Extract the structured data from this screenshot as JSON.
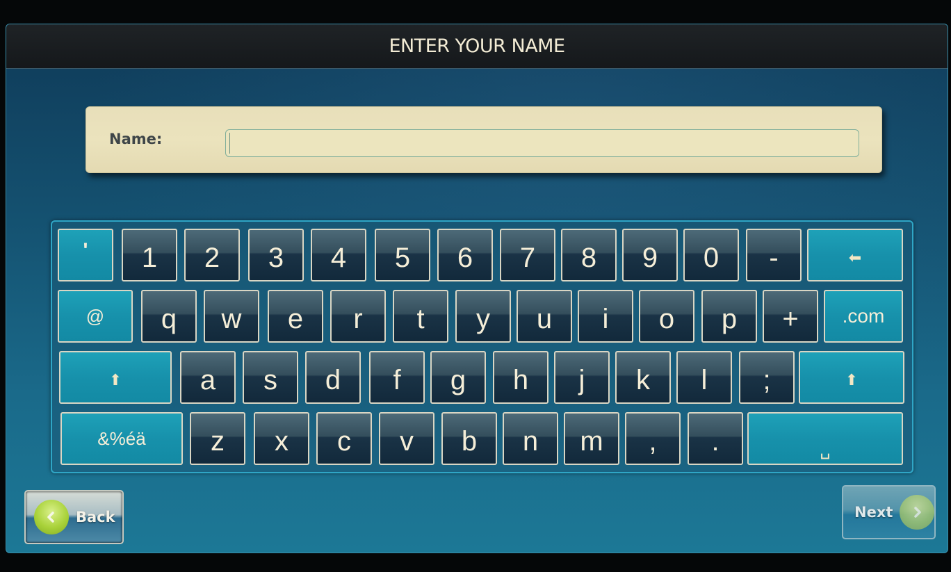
{
  "header": {
    "title": "ENTER YOUR NAME"
  },
  "form": {
    "name_label": "Name:",
    "name_value": "",
    "name_placeholder": ""
  },
  "keyboard": {
    "rows": [
      [
        {
          "id": "apostrophe",
          "label": "'",
          "style": "teal"
        },
        {
          "id": "1",
          "label": "1",
          "style": "dark"
        },
        {
          "id": "2",
          "label": "2",
          "style": "dark"
        },
        {
          "id": "3",
          "label": "3",
          "style": "dark"
        },
        {
          "id": "4",
          "label": "4",
          "style": "dark"
        },
        {
          "id": "5",
          "label": "5",
          "style": "dark"
        },
        {
          "id": "6",
          "label": "6",
          "style": "dark"
        },
        {
          "id": "7",
          "label": "7",
          "style": "dark"
        },
        {
          "id": "8",
          "label": "8",
          "style": "dark"
        },
        {
          "id": "9",
          "label": "9",
          "style": "dark"
        },
        {
          "id": "0",
          "label": "0",
          "style": "dark"
        },
        {
          "id": "hyphen",
          "label": "-",
          "style": "dark"
        },
        {
          "id": "backspace",
          "label": "⬅",
          "icon": "backspace-arrow-icon",
          "style": "teal"
        }
      ],
      [
        {
          "id": "at",
          "label": "@",
          "style": "teal"
        },
        {
          "id": "q",
          "label": "q",
          "style": "dark"
        },
        {
          "id": "w",
          "label": "w",
          "style": "dark"
        },
        {
          "id": "e",
          "label": "e",
          "style": "dark"
        },
        {
          "id": "r",
          "label": "r",
          "style": "dark"
        },
        {
          "id": "t",
          "label": "t",
          "style": "dark"
        },
        {
          "id": "y",
          "label": "y",
          "style": "dark"
        },
        {
          "id": "u",
          "label": "u",
          "style": "dark"
        },
        {
          "id": "i",
          "label": "i",
          "style": "dark"
        },
        {
          "id": "o",
          "label": "o",
          "style": "dark"
        },
        {
          "id": "p",
          "label": "p",
          "style": "dark"
        },
        {
          "id": "plus",
          "label": "+",
          "style": "dark"
        },
        {
          "id": "dotcom",
          "label": ".com",
          "style": "teal"
        }
      ],
      [
        {
          "id": "shift-left",
          "label": "⬆",
          "icon": "shift-arrow-icon",
          "style": "teal"
        },
        {
          "id": "a",
          "label": "a",
          "style": "dark"
        },
        {
          "id": "s",
          "label": "s",
          "style": "dark"
        },
        {
          "id": "d",
          "label": "d",
          "style": "dark"
        },
        {
          "id": "f",
          "label": "f",
          "style": "dark"
        },
        {
          "id": "g",
          "label": "g",
          "style": "dark"
        },
        {
          "id": "h",
          "label": "h",
          "style": "dark"
        },
        {
          "id": "j",
          "label": "j",
          "style": "dark"
        },
        {
          "id": "k",
          "label": "k",
          "style": "dark"
        },
        {
          "id": "l",
          "label": "l",
          "style": "dark"
        },
        {
          "id": "semicolon",
          "label": ";",
          "style": "dark"
        },
        {
          "id": "shift-right",
          "label": "⬆",
          "icon": "shift-arrow-icon",
          "style": "teal"
        }
      ],
      [
        {
          "id": "symbols",
          "label": "&%éä",
          "style": "teal"
        },
        {
          "id": "z",
          "label": "z",
          "style": "dark"
        },
        {
          "id": "x",
          "label": "x",
          "style": "dark"
        },
        {
          "id": "c",
          "label": "c",
          "style": "dark"
        },
        {
          "id": "v",
          "label": "v",
          "style": "dark"
        },
        {
          "id": "b",
          "label": "b",
          "style": "dark"
        },
        {
          "id": "n",
          "label": "n",
          "style": "dark"
        },
        {
          "id": "m",
          "label": "m",
          "style": "dark"
        },
        {
          "id": "comma",
          "label": ",",
          "style": "dark"
        },
        {
          "id": "period",
          "label": ".",
          "style": "dark"
        },
        {
          "id": "space",
          "label": "␣",
          "icon": "space-bar-icon",
          "style": "teal"
        }
      ]
    ]
  },
  "footer": {
    "back_label": "Back",
    "back_icon": "chevron-left-icon",
    "next_label": "Next",
    "next_icon": "chevron-right-icon"
  }
}
